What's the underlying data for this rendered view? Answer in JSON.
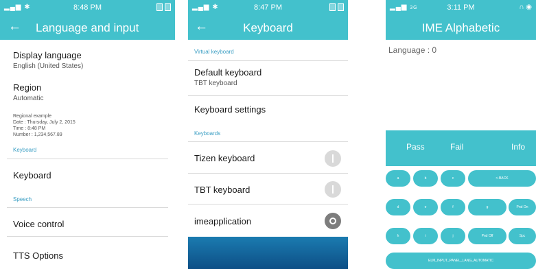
{
  "colors": {
    "accent": "#43c1cc",
    "section_text": "#3a9ec3",
    "divider": "#d9d9d9"
  },
  "screen1": {
    "status": {
      "time": "8:48 PM",
      "signal_icon": "signal-icon",
      "battery_icon": "battery-icon"
    },
    "title": "Language and input",
    "display_language": {
      "title": "Display language",
      "value": "English (United States)"
    },
    "region": {
      "title": "Region",
      "value": "Automatic"
    },
    "regional_example": {
      "label": "Regional example",
      "date": "Date : Thursday, July 2, 2015",
      "time": "Time : 8:48 PM",
      "number": "Number : 1,234,567.89"
    },
    "section_keyboard": "Keyboard",
    "keyboard_item": "Keyboard",
    "section_speech": "Speech",
    "voice_control": "Voice control",
    "tts_options": "TTS Options"
  },
  "screen2": {
    "status": {
      "time": "8:47 PM"
    },
    "title": "Keyboard",
    "section_virtual": "Virtual keyboard",
    "default_keyboard": {
      "title": "Default keyboard",
      "value": "TBT keyboard"
    },
    "keyboard_settings": "Keyboard settings",
    "section_keyboards": "Keyboards",
    "keyboards": [
      {
        "label": "Tizen keyboard",
        "state": "off"
      },
      {
        "label": "TBT keyboard",
        "state": "off"
      },
      {
        "label": "imeapplication",
        "state": "on"
      }
    ]
  },
  "screen3": {
    "status": {
      "time": "3:11 PM",
      "network": "3G"
    },
    "title": "IME Alphabetic",
    "language_label": "Language : 0",
    "buttons": {
      "pass": "Pass",
      "fail": "Fail",
      "info": "Info"
    },
    "keys": {
      "a": "a",
      "b": "b",
      "c": "c",
      "back": "<-BACK",
      "d": "d",
      "e": "e",
      "f": "f",
      "g": "g",
      "pnd_on": "Pnd On",
      "h": "h",
      "i": "i",
      "j": "j",
      "pnd_off": "Pnd Off",
      "spc": "Spc",
      "lang_auto": "ELM_INPUT_PANEL_LANG_AUTOMATIC"
    }
  }
}
